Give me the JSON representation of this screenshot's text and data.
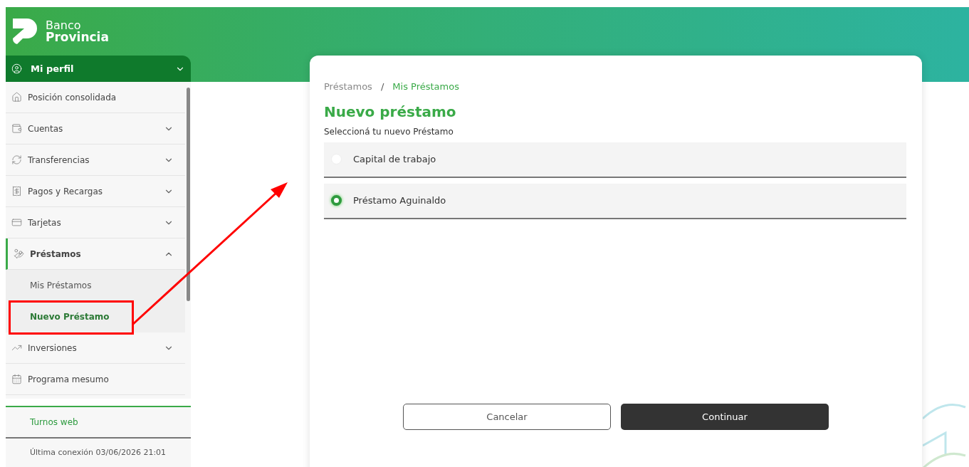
{
  "brand": {
    "line1": "Banco",
    "line2": "Provincia"
  },
  "profile": {
    "label": "Mi perfil",
    "expanded": false
  },
  "sidebar": {
    "items": [
      {
        "label": "Posición consolidada",
        "selected": false
      },
      {
        "label": "Cuentas",
        "expanded": false,
        "selected": false
      },
      {
        "label": "Transferencias",
        "expanded": false,
        "selected": false
      },
      {
        "label": "Pagos y Recargas",
        "expanded": false,
        "selected": false
      },
      {
        "label": "Tarjetas",
        "expanded": false,
        "selected": false
      },
      {
        "label": "Préstamos",
        "expanded": true,
        "selected": true,
        "children": [
          {
            "label": "Mis Préstamos",
            "selected": false
          },
          {
            "label": "Nuevo Préstamo",
            "selected": true
          }
        ]
      },
      {
        "label": "Inversiones",
        "expanded": false,
        "selected": false
      },
      {
        "label": "Programa mesumo",
        "selected": false
      }
    ],
    "footer_link": "Turnos web",
    "last_login": "Última conexión 03/06/2026 21:01"
  },
  "breadcrumb": [
    {
      "label": "Préstamos",
      "selected": false
    },
    {
      "label": "Mis Préstamos",
      "selected": true
    }
  ],
  "breadcrumb_separator": "/",
  "title": "Nuevo préstamo",
  "subtitle": "Seleccioná tu nuevo Préstamo",
  "options": [
    {
      "label": "Capital de trabajo",
      "selected": false
    },
    {
      "label": "Préstamo Aguinaldo",
      "selected": true
    }
  ],
  "buttons": [
    {
      "label": "Cancelar",
      "kind": "secondary"
    },
    {
      "label": "Continuar",
      "kind": "primary"
    }
  ]
}
